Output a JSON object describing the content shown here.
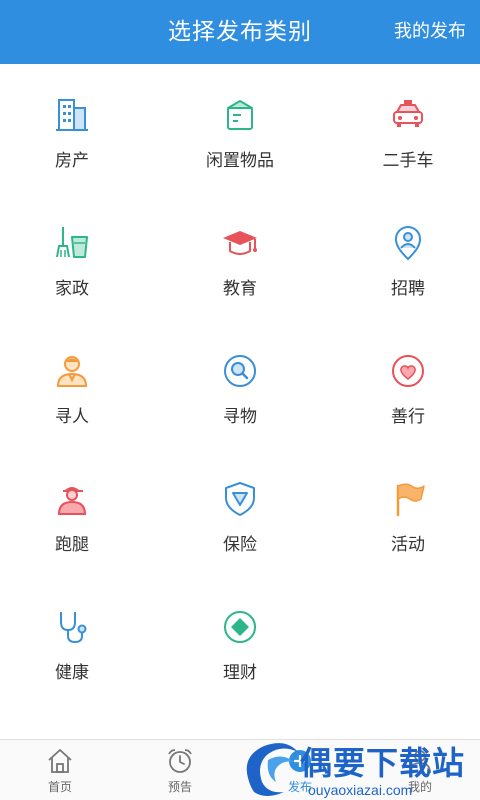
{
  "header": {
    "title": "选择发布类别",
    "right_action": "我的发布"
  },
  "categories": [
    {
      "label": "房产",
      "icon": "building-icon"
    },
    {
      "label": "闲置物品",
      "icon": "box-icon"
    },
    {
      "label": "二手车",
      "icon": "car-icon"
    },
    {
      "label": "家政",
      "icon": "broom-bucket-icon"
    },
    {
      "label": "教育",
      "icon": "graduation-cap-icon"
    },
    {
      "label": "招聘",
      "icon": "person-pin-icon"
    },
    {
      "label": "寻人",
      "icon": "person-icon"
    },
    {
      "label": "寻物",
      "icon": "magnifier-icon"
    },
    {
      "label": "善行",
      "icon": "heart-icon"
    },
    {
      "label": "跑腿",
      "icon": "courier-icon"
    },
    {
      "label": "保险",
      "icon": "shield-icon"
    },
    {
      "label": "活动",
      "icon": "flag-icon"
    },
    {
      "label": "健康",
      "icon": "stethoscope-icon"
    },
    {
      "label": "理财",
      "icon": "diamond-icon"
    }
  ],
  "tabbar": {
    "items": [
      {
        "label": "首页",
        "icon": "home-icon"
      },
      {
        "label": "预告",
        "icon": "alarm-clock-icon"
      },
      {
        "label": "发布",
        "icon": "publish-icon"
      },
      {
        "label": "我的",
        "icon": "user-icon"
      }
    ]
  },
  "watermark": {
    "title": "偶要下载站",
    "url": "ouyaoxiazai.com"
  },
  "colors": {
    "header_bg": "#2f8ee0",
    "blue_icon": "#3a8fd9",
    "green_icon": "#2fb58a",
    "red_icon": "#e8525a",
    "orange_icon": "#f39a3a",
    "watermark": "#1e64c8"
  }
}
